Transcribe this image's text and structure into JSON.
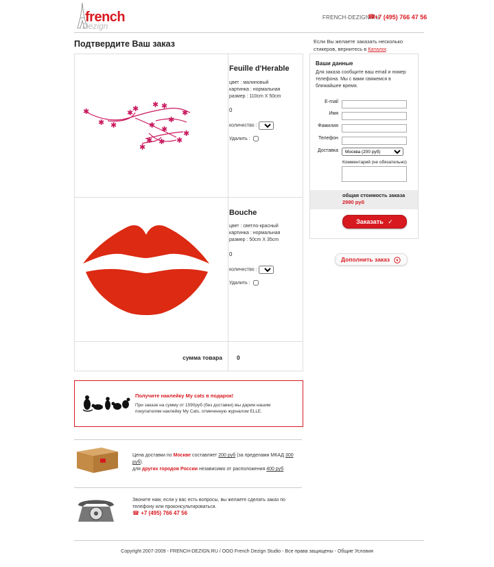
{
  "header": {
    "logo_word": "french",
    "logo_sub": "Dezign",
    "site": "FRENCH-DEZIGN.RU",
    "phone": "+7 (495) 766 47 56"
  },
  "page_title": "Подтвердите Ваш заказ",
  "sidebar_note": {
    "text": "Если Вы желаете заказать несколько стикеров, вернитесь в ",
    "link": "Каталог",
    "after": "."
  },
  "products": [
    {
      "name": "Feuille d'Herable",
      "details": [
        "цвет : малиновый",
        "картинка : нормальная",
        "размер : 110cm X 50cm"
      ],
      "price": "0",
      "qty_label": "количество :",
      "qty": "1",
      "delete_label": "Удалить :"
    },
    {
      "name": "Bouche",
      "details": [
        "цвет : светло-красный",
        "картинка : нормальная",
        "размер : 50cm X 35cm"
      ],
      "price": "0",
      "qty_label": "количество :",
      "qty": "1",
      "delete_label": "Удалить :"
    }
  ],
  "cart_total": {
    "label": "сумма товара",
    "value": "0"
  },
  "form": {
    "title": "Ваши данные",
    "desc": "Для заказа сообщите ваш email и номер телефона. Мы с вами свяжемся в ближайшее время.",
    "fields": [
      {
        "label": "E-mail",
        "value": ""
      },
      {
        "label": "Имя",
        "value": ""
      },
      {
        "label": "Фамилия",
        "value": ""
      },
      {
        "label": "Телефон",
        "value": ""
      }
    ],
    "delivery_label": "Доставка",
    "delivery_value": "Москва (200 руб)",
    "comment_label": "Комментарий (не обязательно)",
    "total_label": "общая стоимость заказа",
    "total_value": "2980 руб",
    "order_button": "Заказать",
    "order_check": "✓"
  },
  "addmore_button": "Дополнить заказ",
  "promo": {
    "title": "Получите наклейку My cats в подарок!",
    "text": "При заказе на сумму от 1590руб (без доставки) мы дарим нашим покупателям наклейку My Cats, отмеченную журналом ELLE."
  },
  "delivery_info": {
    "p1": "Цена доставки по ",
    "moscow": "Москве",
    "p2": " составляет ",
    "price1": "200 руб",
    "p3": " (за пределами МКАД ",
    "price2": "300 руб",
    "p4": ").",
    "p5": "для ",
    "other": "других городов России",
    "p6": " независимо от расположения ",
    "price3": "400 руб"
  },
  "phone_info": {
    "text": "Звоните нам, если у вас есть вопросы, вы желаете сделать заказ по телефону или проконсультироваться.",
    "phone": "+7 (495) 766 47 56"
  },
  "footer": {
    "copyright": "Copyright 2007-2009 - ",
    "site": "FRENCH-DEZIGN.RU",
    "rest": " / ООО French Dezign Studio - Все права защищены - ",
    "terms": "Общие Условия"
  },
  "colors": {
    "accent": "#d71920",
    "leaf": "#c8175d",
    "lips": "#dc2a13"
  }
}
